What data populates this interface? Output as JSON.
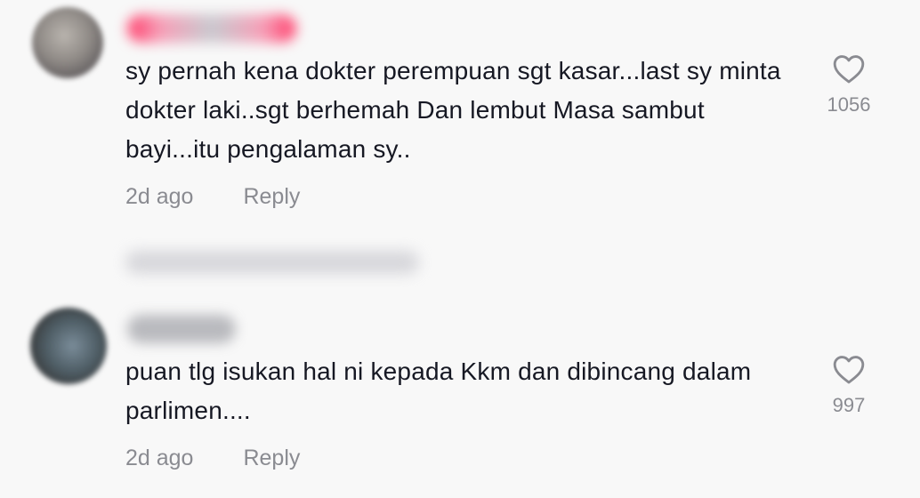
{
  "comments": [
    {
      "username": "",
      "text": "sy pernah kena dokter perempuan sgt kasar...last sy minta dokter laki..sgt berhemah Dan lembut Masa sambut bayi...itu pengalaman sy..",
      "time": "2d ago",
      "reply_label": "Reply",
      "like_count": "1056",
      "like_icon": "heart-outline-icon"
    },
    {
      "username": "",
      "text": "puan tlg isukan hal ni kepada Kkm dan dibincang dalam parlimen....",
      "time": "2d ago",
      "reply_label": "Reply",
      "like_count": "997",
      "like_icon": "heart-outline-icon"
    }
  ],
  "view_more_replies": ""
}
